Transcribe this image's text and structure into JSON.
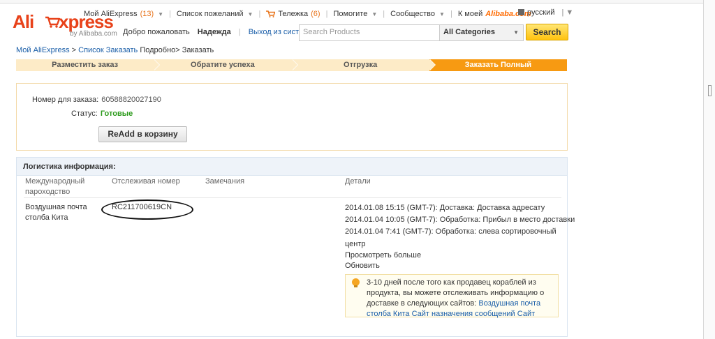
{
  "logo": {
    "ali": "Ali",
    "express": "xpress",
    "by": "by Alibaba.com"
  },
  "topnav": {
    "my_aliexpress": "Мой AliExpress",
    "my_aliexpress_count": "(13)",
    "wishlist": "Список пожеланий",
    "cart": "Тележка",
    "cart_count": "(6)",
    "help": "Помогите",
    "community": "Сообщество",
    "my_alibaba": "К моей",
    "alibaba": "Alibaba.com",
    "language": "русский"
  },
  "welcome": {
    "greeting": "Добро пожаловать",
    "user": "Надежда",
    "logout": "Выход из системы"
  },
  "search": {
    "placeholder": "Search Products",
    "category": "All Categories",
    "button": "Search"
  },
  "breadcrumb": {
    "my": "Мой AliExpress",
    "sep1": " > ",
    "orders": "Список Заказать",
    "rest": " Подробно> Заказать"
  },
  "steps": [
    {
      "label": "Разместить заказ"
    },
    {
      "label": "Обратите успеха"
    },
    {
      "label": "Отгрузка"
    },
    {
      "label": "Заказать Полный"
    }
  ],
  "order": {
    "number_label": "Номер для заказа:",
    "number_value": "60588820027190",
    "status_label": "Статус:",
    "status_value": "Готовые",
    "readd_button": "ReAdd в корзину"
  },
  "logistics": {
    "title": "Логистика информация:",
    "columns": {
      "carrier": "Международный пароходство",
      "tracking": "Отслеживая номер",
      "notes": "Замечания",
      "details": "Детали"
    },
    "row": {
      "carrier": "Воздушная почта столба Кита",
      "tracking": "RC211700619CN",
      "details": [
        "2014.01.08 15:15 (GMT-7): Доставка: Доставка адресату",
        "2014.01.04 10:05 (GMT-7): Обработка: Прибыл в место доставки",
        "2014.01.04 7:41 (GMT-7): Обработка: слева сортировочный",
        "центр"
      ],
      "view_more": "Просмотреть больше",
      "refresh": "Обновить",
      "notice_text": "3-10 дней после того как продавец кораблей из продукта, вы можете отслеживать информацию о доставке в следующих сайтов:",
      "notice_link": "Воздушная почта столба Кита Сайт назначения сообщений Сайт"
    }
  },
  "colors": {
    "brand": "#e8421a",
    "step_active": "#f79a12",
    "step_inactive": "#fdebc7",
    "status_ok": "#2b9a1a",
    "link": "#1a5ea8"
  }
}
